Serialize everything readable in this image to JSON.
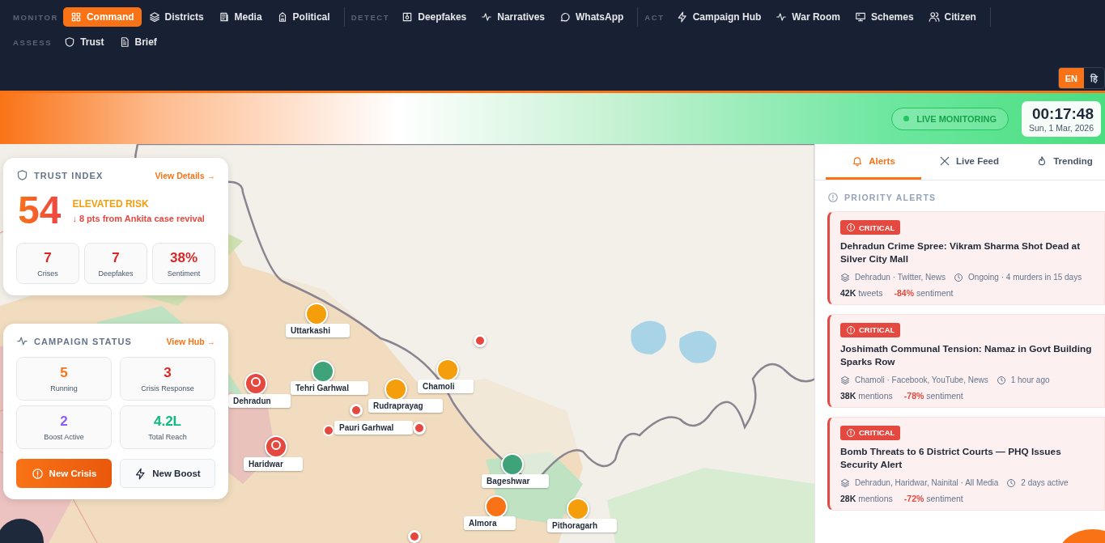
{
  "nav": {
    "groups": [
      {
        "label": "MONITOR",
        "items": [
          {
            "label": "Command",
            "kind": "grid",
            "selected": true
          },
          {
            "label": "Districts",
            "kind": "layers",
            "selected": false
          },
          {
            "label": "Media",
            "kind": "newspaper",
            "selected": false
          },
          {
            "label": "Political",
            "kind": "building",
            "selected": false
          }
        ]
      },
      {
        "label": "DETECT",
        "items": [
          {
            "label": "Deepfakes",
            "kind": "scan",
            "selected": false
          },
          {
            "label": "Narratives",
            "kind": "pulse",
            "selected": false
          },
          {
            "label": "WhatsApp",
            "kind": "chat",
            "selected": false
          }
        ]
      },
      {
        "label": "ACT",
        "items": [
          {
            "label": "Campaign Hub",
            "kind": "bolt",
            "selected": false
          },
          {
            "label": "War Room",
            "kind": "pulse",
            "selected": false
          },
          {
            "label": "Schemes",
            "kind": "monitor",
            "selected": false
          },
          {
            "label": "Citizen",
            "kind": "users",
            "selected": false
          }
        ]
      },
      {
        "label": "ASSESS",
        "items": [
          {
            "label": "Trust",
            "kind": "shield",
            "selected": false
          },
          {
            "label": "Brief",
            "kind": "file",
            "selected": false
          }
        ]
      }
    ],
    "languages": [
      {
        "label": "EN",
        "selected": true
      },
      {
        "label": "हि",
        "selected": false
      }
    ]
  },
  "status": {
    "live": "LIVE MONITORING",
    "time": "00:17:48",
    "date": "Sun, 1 Mar, 2026"
  },
  "trust": {
    "title": "TRUST INDEX",
    "link": "View Details →",
    "score": "54",
    "risk": "ELEVATED RISK",
    "change": "↓ 8 pts from Ankita case revival",
    "stats": [
      {
        "value": "7",
        "label": "Crises",
        "color": "#dc2626"
      },
      {
        "value": "7",
        "label": "Deepfakes",
        "color": "#dc2626"
      },
      {
        "value": "38%",
        "label": "Sentiment",
        "color": "#dc2626"
      }
    ]
  },
  "campaign": {
    "title": "CAMPAIGN STATUS",
    "link": "View Hub →",
    "stats": [
      {
        "value": "5",
        "label": "Running",
        "color": "#f97316"
      },
      {
        "value": "3",
        "label": "Crisis Response",
        "color": "#dc2626"
      },
      {
        "value": "2",
        "label": "Boost Active",
        "color": "#8b5cf6"
      },
      {
        "value": "4.2L",
        "label": "Total Reach",
        "color": "#10b981"
      }
    ],
    "buttons": [
      {
        "label": "New Crisis",
        "kind": "primary"
      },
      {
        "label": "New Boost",
        "kind": "secondary"
      }
    ]
  },
  "map": {
    "markers": [
      {
        "kind": "district",
        "label": "Uttarkashi",
        "color": "#f59e0b"
      },
      {
        "kind": "district",
        "label": "Tehri Garhwal",
        "color": "#3fa37a"
      },
      {
        "kind": "hotspot",
        "label": "Dehradun",
        "color": "#e5483f"
      },
      {
        "kind": "district",
        "label": "Chamoli",
        "color": "#f59e0b"
      },
      {
        "kind": "district",
        "label": "Rudraprayag",
        "color": "#f59e0b"
      },
      {
        "kind": "label",
        "label": "Pauri Garhwal",
        "color": "#e5483f"
      },
      {
        "kind": "hotspot",
        "label": "Haridwar",
        "color": "#e5483f"
      },
      {
        "kind": "district",
        "label": "Bageshwar",
        "color": "#3fa37a"
      },
      {
        "kind": "district",
        "label": "Almora",
        "color": "#f97316"
      },
      {
        "kind": "district",
        "label": "Pithoragarh",
        "color": "#f59e0b"
      },
      {
        "kind": "alert",
        "color": "#e5483f"
      },
      {
        "kind": "alert",
        "color": "#e5483f"
      },
      {
        "kind": "alert",
        "color": "#e5483f"
      },
      {
        "kind": "alert",
        "color": "#e5483f"
      }
    ]
  },
  "panel": {
    "tabs": [
      {
        "label": "Alerts",
        "kind": "bell",
        "selected": true
      },
      {
        "label": "Live Feed",
        "kind": "x",
        "selected": false
      },
      {
        "label": "Trending",
        "kind": "flame",
        "selected": false
      }
    ],
    "heading": "PRIORITY ALERTS",
    "alerts": [
      {
        "badge": "CRITICAL",
        "title": "Dehradun Crime Spree: Vikram Sharma Shot Dead at Silver City Mall",
        "source": "Dehradun · Twitter, News",
        "time": "Ongoing · 4 murders in 15 days",
        "count": "42K",
        "count_unit": "tweets",
        "sentiment": "-84%",
        "sentiment_unit": "sentiment"
      },
      {
        "badge": "CRITICAL",
        "title": "Joshimath Communal Tension: Namaz in Govt Building Sparks Row",
        "source": "Chamoli · Facebook, YouTube, News",
        "time": "1 hour ago",
        "count": "38K",
        "count_unit": "mentions",
        "sentiment": "-78%",
        "sentiment_unit": "sentiment"
      },
      {
        "badge": "CRITICAL",
        "title": "Bomb Threats to 6 District Courts — PHQ Issues Security Alert",
        "source": "Dehradun, Haridwar, Nainital · All Media",
        "time": "2 days active",
        "count": "28K",
        "count_unit": "mentions",
        "sentiment": "-72%",
        "sentiment_unit": "sentiment"
      }
    ]
  }
}
